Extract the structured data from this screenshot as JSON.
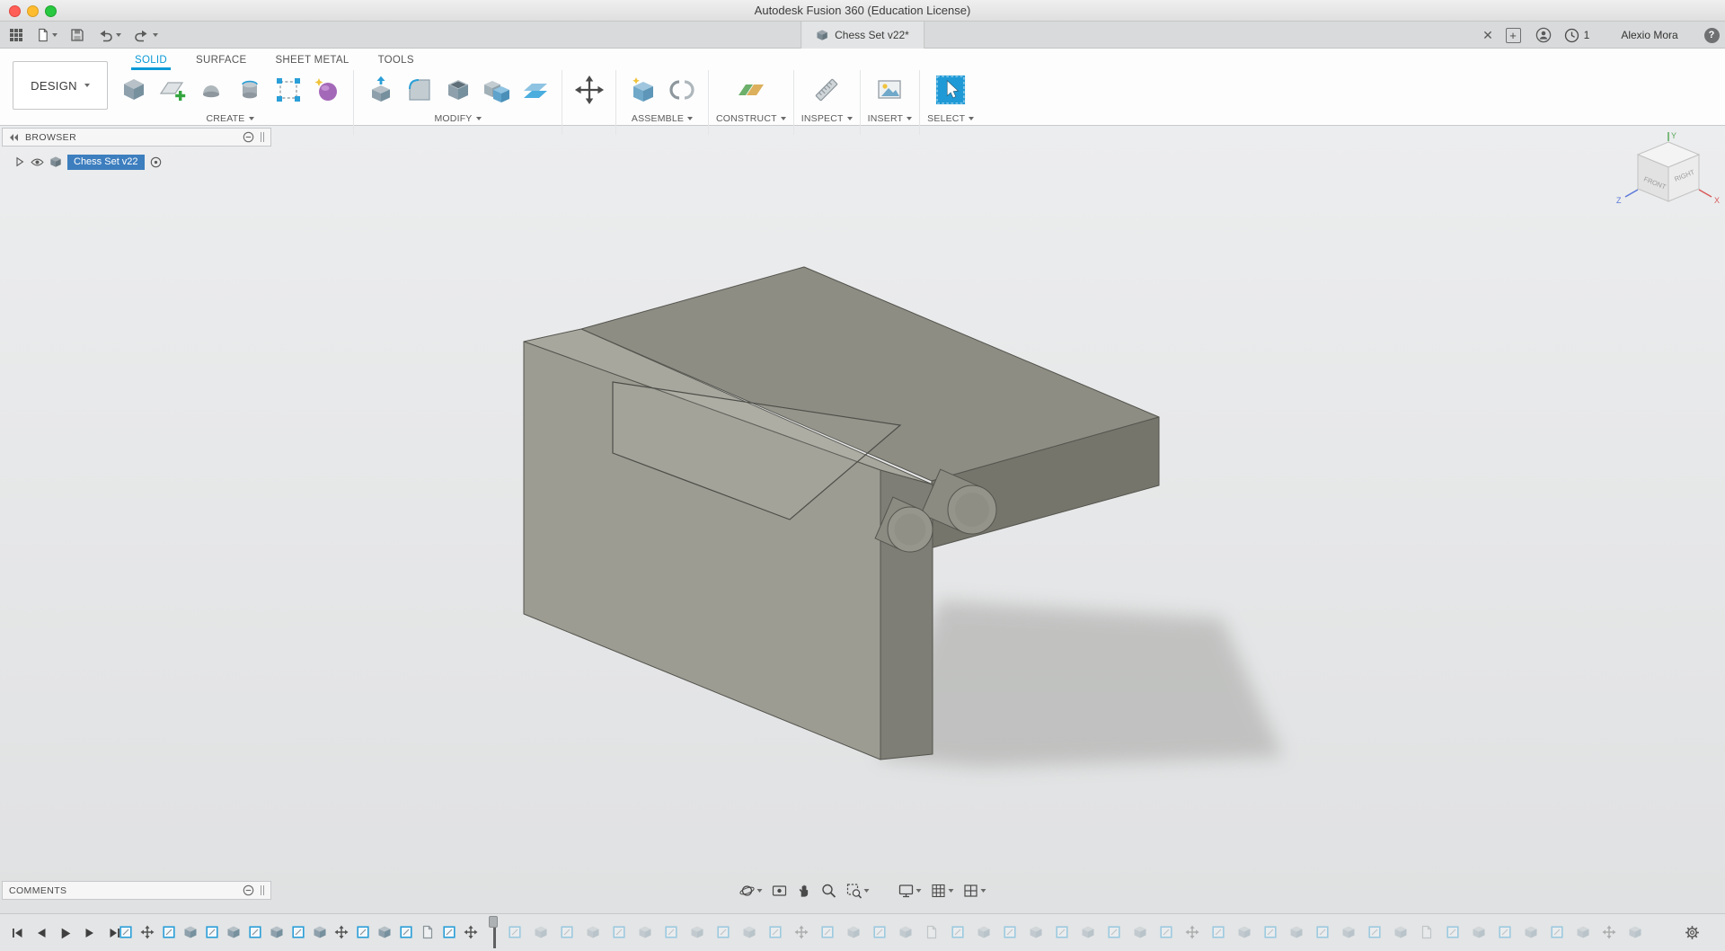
{
  "window": {
    "title": "Autodesk Fusion 360 (Education License)"
  },
  "tabbar": {
    "document_tab": {
      "label": "Chess Set v22*"
    },
    "close_glyph": "✕",
    "new_tab_glyph": "+",
    "job_count": "1",
    "user": "Alexio Mora",
    "help_glyph": "?"
  },
  "ribbon": {
    "workspace": "DESIGN",
    "tabs": [
      {
        "label": "SOLID",
        "active": true
      },
      {
        "label": "SURFACE",
        "active": false
      },
      {
        "label": "SHEET METAL",
        "active": false
      },
      {
        "label": "TOOLS",
        "active": false
      }
    ],
    "groups": [
      "CREATE",
      "MODIFY",
      "ASSEMBLE",
      "CONSTRUCT",
      "INSPECT",
      "INSERT",
      "SELECT"
    ],
    "create_tools": [
      "box",
      "create-sketch",
      "revolve",
      "cylinder",
      "rectangular-pattern",
      "create-form"
    ],
    "modify_tools": [
      "press-pull",
      "fillet",
      "shell",
      "combine",
      "offset-face",
      "move-copy"
    ],
    "assemble_tools": [
      "new-component",
      "joint"
    ],
    "construct_tools": [
      "construction-plane"
    ],
    "inspect_tools": [
      "measure"
    ],
    "insert_tools": [
      "insert-canvas"
    ],
    "select_tools": [
      "select"
    ]
  },
  "browser": {
    "title": "BROWSER",
    "root_item": "Chess Set v22"
  },
  "comments": {
    "title": "COMMENTS"
  },
  "viewcube": {
    "front": "FRONT",
    "right": "RIGHT",
    "x": "X",
    "y": "Y",
    "z": "Z"
  },
  "navbar": {
    "icons": [
      "orbit",
      "look-at",
      "pan",
      "zoom",
      "zoom-window",
      "display-settings",
      "grid-snaps",
      "viewports"
    ]
  },
  "timeline": {
    "playback": [
      "go-to-start",
      "step-back",
      "play",
      "step-forward",
      "go-to-end"
    ],
    "features": [
      "sketch",
      "move",
      "sketch",
      "extrude",
      "sketch",
      "extrude",
      "sketch",
      "extrude",
      "sketch",
      "extrude",
      "move",
      "sketch",
      "extrude",
      "sketch",
      "doc",
      "sketch",
      "move"
    ],
    "rolled_back": [
      "sketch",
      "extrude",
      "sketch",
      "extrude",
      "sketch",
      "extrude",
      "sketch",
      "extrude",
      "sketch",
      "extrude",
      "sketch",
      "move",
      "sketch",
      "extrude",
      "sketch",
      "extrude",
      "doc",
      "sketch",
      "extrude",
      "sketch",
      "extrude",
      "sketch",
      "extrude",
      "sketch",
      "extrude",
      "sketch",
      "move",
      "sketch",
      "extrude",
      "sketch",
      "extrude",
      "sketch",
      "extrude",
      "sketch",
      "extrude",
      "doc",
      "sketch",
      "extrude",
      "sketch",
      "extrude",
      "sketch",
      "extrude",
      "move",
      "extrude"
    ]
  },
  "colors": {
    "accent_blue": "#0a99d6",
    "selection_blue": "#3d7ebf",
    "canvas_grey": "#e8e9ea"
  }
}
